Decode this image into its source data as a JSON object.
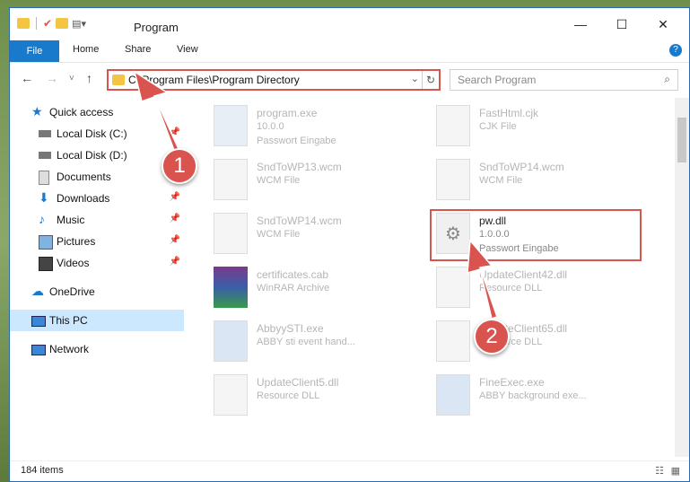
{
  "window": {
    "title": "Program"
  },
  "ribbon": {
    "file": "File",
    "home": "Home",
    "share": "Share",
    "view": "View",
    "help": "?"
  },
  "address": {
    "path": "C:\\Program Files\\Program Directory"
  },
  "search": {
    "placeholder": "Search Program"
  },
  "sidebar": {
    "items": [
      {
        "label": "Quick access"
      },
      {
        "label": "Local Disk (C:)"
      },
      {
        "label": "Local Disk (D:)"
      },
      {
        "label": "Documents"
      },
      {
        "label": "Downloads"
      },
      {
        "label": "Music"
      },
      {
        "label": "Pictures"
      },
      {
        "label": "Videos"
      },
      {
        "label": "OneDrive"
      },
      {
        "label": "This PC"
      },
      {
        "label": "Network"
      }
    ]
  },
  "files": [
    {
      "name": "program.exe",
      "line2": "10.0.0",
      "line3": "Passwort Eingabe"
    },
    {
      "name": "FastHtml.cjk",
      "line2": "CJK File",
      "line3": ""
    },
    {
      "name": "SndToWP13.wcm",
      "line2": "WCM File",
      "line3": ""
    },
    {
      "name": "SndToWP14.wcm",
      "line2": "WCM File",
      "line3": ""
    },
    {
      "name": "SndToWP14.wcm",
      "line2": "WCM File",
      "line3": ""
    },
    {
      "name": "pw.dll",
      "line2": "1.0.0.0",
      "line3": "Passwort Eingabe"
    },
    {
      "name": "certificates.cab",
      "line2": "WinRAR Archive",
      "line3": ""
    },
    {
      "name": "UpdateClient42.dll",
      "line2": "Resource DLL",
      "line3": ""
    },
    {
      "name": "AbbyySTI.exe",
      "line2": "ABBY sti event hand...",
      "line3": ""
    },
    {
      "name": "UpdateClient65.dll",
      "line2": "Resource DLL",
      "line3": ""
    },
    {
      "name": "UpdateClient5.dll",
      "line2": "Resource DLL",
      "line3": ""
    },
    {
      "name": "FineExec.exe",
      "line2": "ABBY background exe...",
      "line3": ""
    }
  ],
  "status": {
    "count": "184 items"
  },
  "callouts": {
    "one": "1",
    "two": "2"
  },
  "colors": {
    "accent": "#1979ca",
    "highlight": "#d9534f"
  }
}
